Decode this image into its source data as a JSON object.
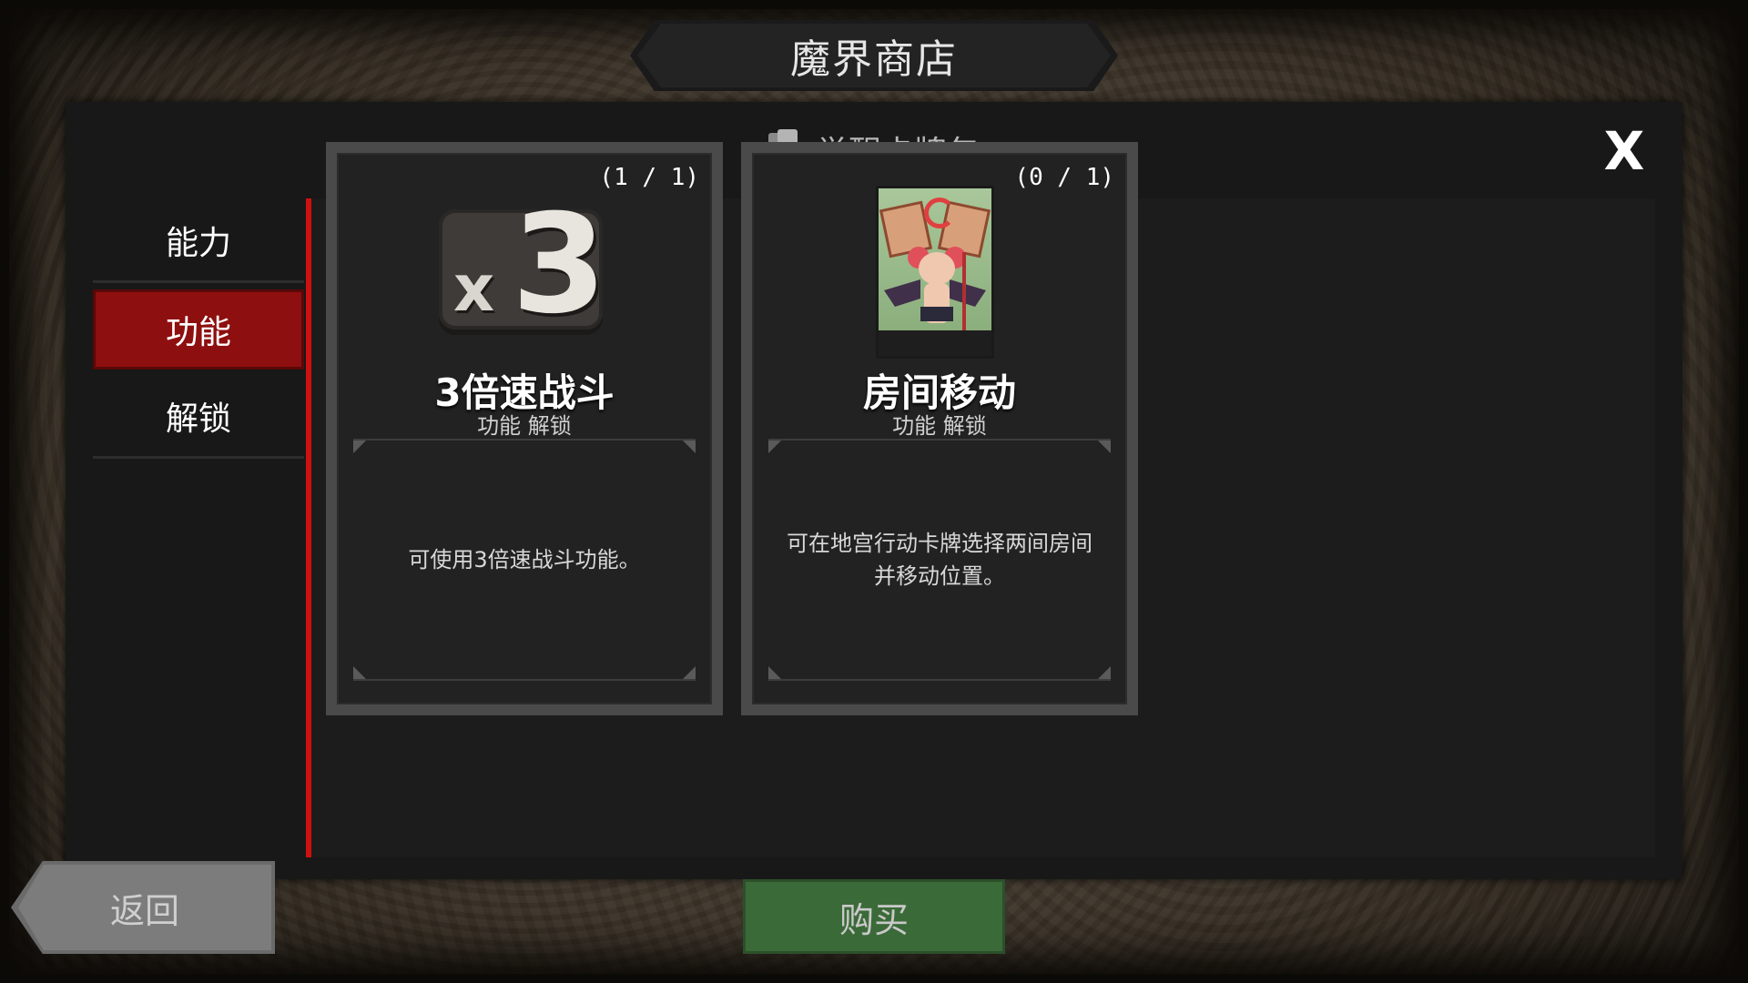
{
  "shop": {
    "title": "魔界商店"
  },
  "panel": {
    "title": "觉醒卡牌包",
    "pack_icon": "card-pack-icon",
    "close_label": "X"
  },
  "sidebar": {
    "items": [
      {
        "label": "能力",
        "active": false
      },
      {
        "label": "功能",
        "active": true
      },
      {
        "label": "解锁",
        "active": false
      }
    ]
  },
  "cards": [
    {
      "count": "(1 / 1)",
      "icon": "x3-speed-icon",
      "icon_x": "x",
      "icon_3": "3",
      "name": "3倍速战斗",
      "type": "功能  解锁",
      "description": "可使用3倍速战斗功能。"
    },
    {
      "count": "(0 / 1)",
      "icon": "room-move-card-art",
      "name": "房间移动",
      "type": "功能  解锁",
      "description": "可在地宫行动卡牌选择两间房间并移动位置。"
    }
  ],
  "footer": {
    "back_label": "返回",
    "buy_label": "购买"
  },
  "colors": {
    "accent_red": "#d01010",
    "active_tab": "#8e0f0f",
    "buy_green": "#3b6a39",
    "panel_bg": "#181818"
  }
}
